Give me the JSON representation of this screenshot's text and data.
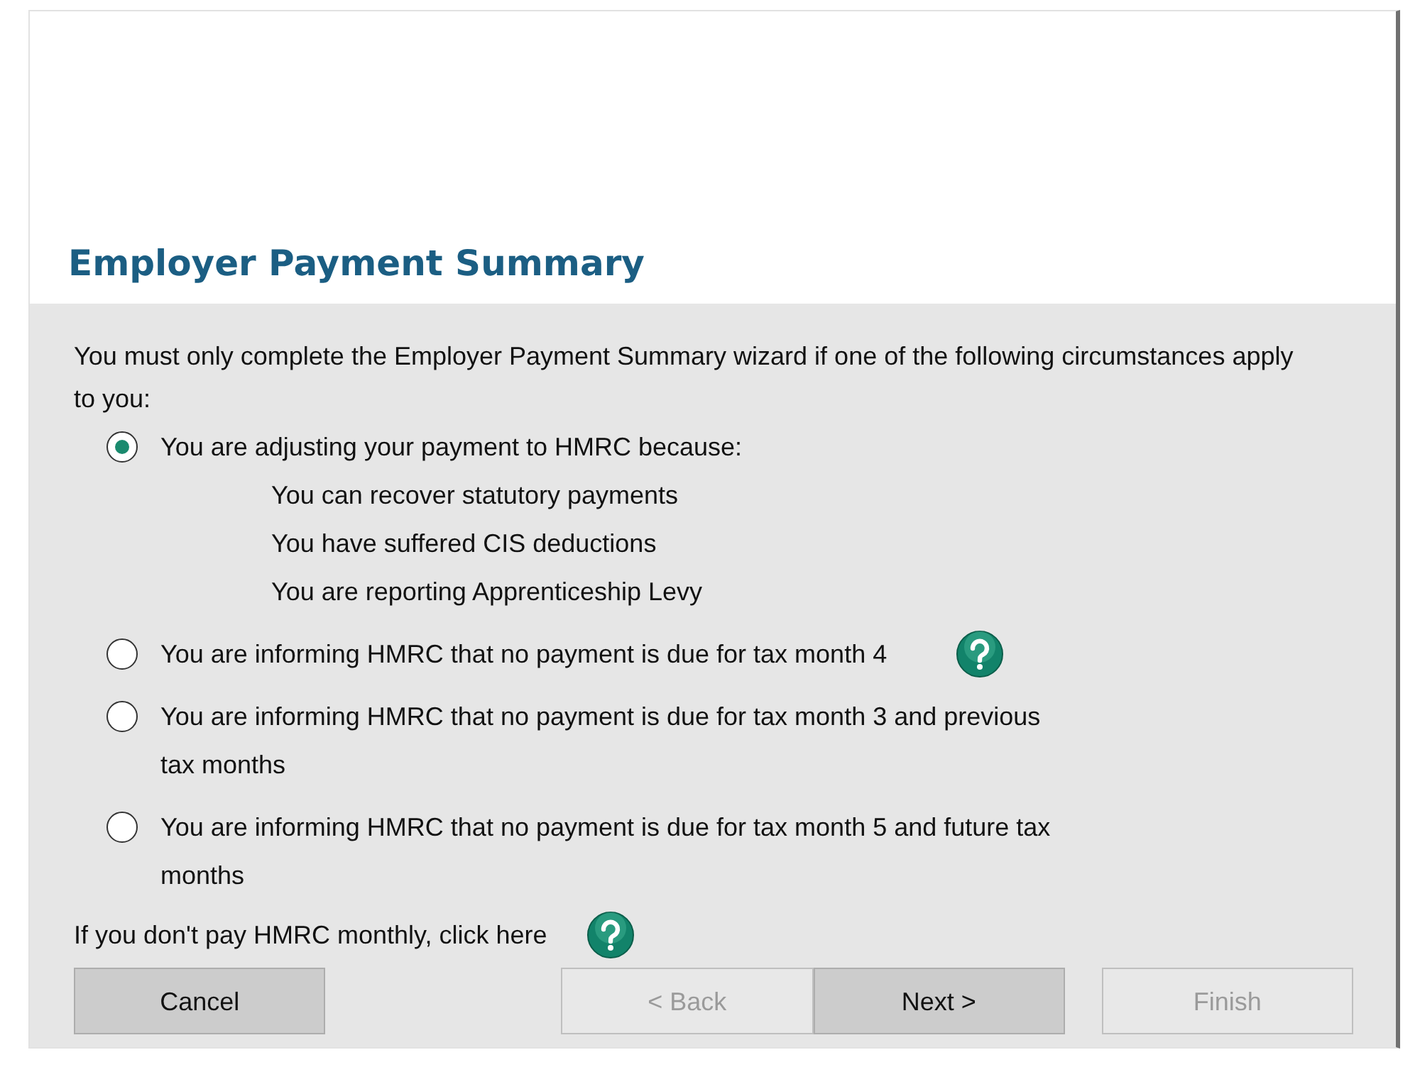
{
  "title": "Employer Payment Summary",
  "intro": "You must only complete the Employer Payment Summary wizard if one of the following circumstances apply to you:",
  "options": [
    {
      "label": "You are adjusting your payment to HMRC because:",
      "selected": true,
      "help": false,
      "details": [
        "You can recover statutory payments",
        "You have suffered CIS deductions",
        "You are reporting Apprenticeship Levy"
      ]
    },
    {
      "label": "You are informing HMRC that no payment is due for tax month 4",
      "selected": false,
      "help": true
    },
    {
      "label": "You are informing HMRC that no payment is due for tax month 3 and previous tax months",
      "selected": false,
      "help": false
    },
    {
      "label": "You are informing HMRC that no payment is due for tax month 5 and future tax months",
      "selected": false,
      "help": false
    }
  ],
  "footer_note": "If you don't pay HMRC monthly, click here",
  "buttons": [
    {
      "label": "Cancel",
      "disabled": false
    },
    {
      "label": "< Back",
      "disabled": true
    },
    {
      "label": "Next >",
      "disabled": false
    },
    {
      "label": "Finish",
      "disabled": true
    }
  ]
}
